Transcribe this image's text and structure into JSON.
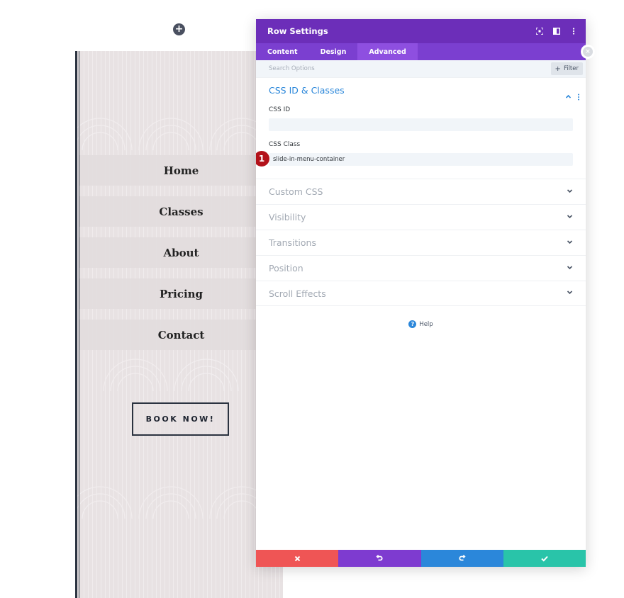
{
  "canvas": {
    "add_icon": "plus-icon"
  },
  "preview": {
    "menu_items": [
      "Home",
      "Classes",
      "About",
      "Pricing",
      "Contact"
    ],
    "cta_label": "BOOK NOW!"
  },
  "modal": {
    "title": "Row Settings",
    "tabs": [
      {
        "label": "Content",
        "active": false
      },
      {
        "label": "Design",
        "active": false
      },
      {
        "label": "Advanced",
        "active": true
      }
    ],
    "search_placeholder": "Search Options",
    "filter_label": "Filter",
    "open_section": {
      "title": "CSS ID & Classes",
      "css_id_label": "CSS ID",
      "css_id_value": "",
      "css_class_label": "CSS Class",
      "css_class_value": "slide-in-menu-container",
      "step_badge": "1"
    },
    "closed_sections": [
      "Custom CSS",
      "Visibility",
      "Transitions",
      "Position",
      "Scroll Effects"
    ],
    "help_label": "Help",
    "footer_colors": {
      "cancel": "#ef5555",
      "undo": "#7e3bd0",
      "redo": "#2b87da",
      "save": "#29c4a9"
    }
  },
  "colors": {
    "header": "#6c2eb9",
    "tabs": "#7b3fd0",
    "accent": "#2b87da"
  }
}
